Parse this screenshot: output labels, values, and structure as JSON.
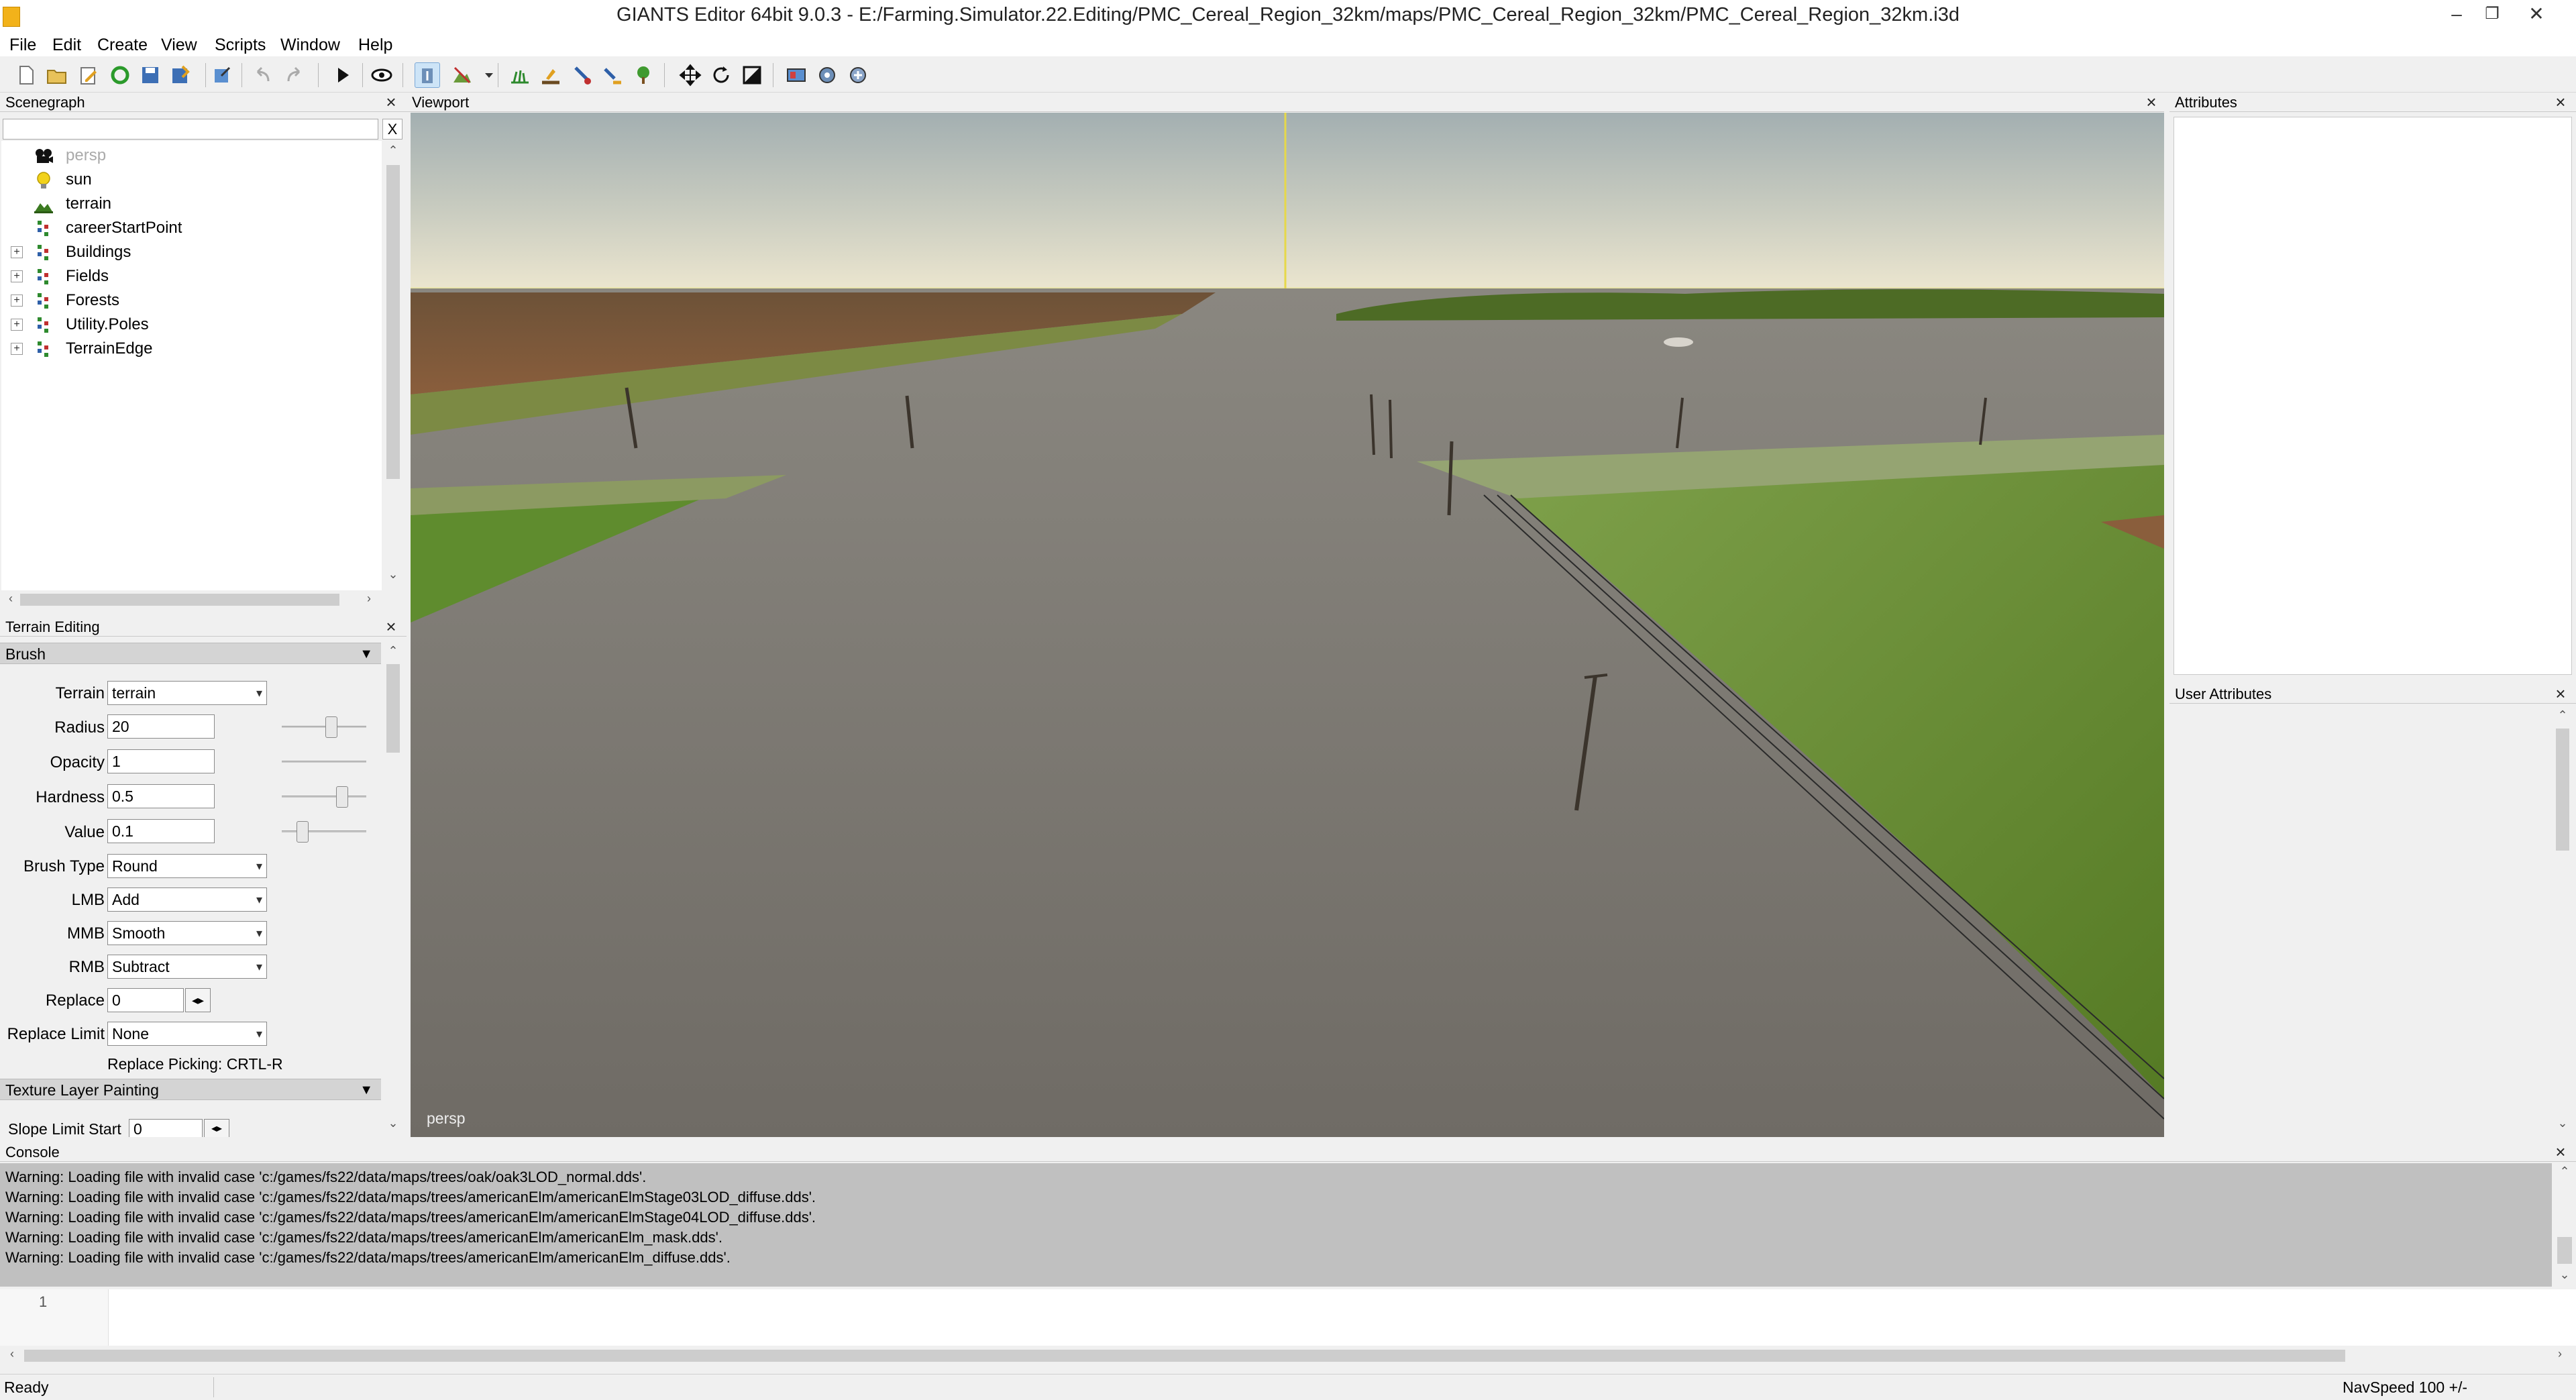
{
  "window": {
    "title": "GIANTS Editor 64bit 9.0.3 - E:/Farming.Simulator.22.Editing/PMC_Cereal_Region_32km/maps/PMC_Cereal_Region_32km/PMC_Cereal_Region_32km.i3d",
    "minimize": "–",
    "restore": "❐",
    "close": "✕"
  },
  "menu": [
    "File",
    "Edit",
    "Create",
    "View",
    "Scripts",
    "Window",
    "Help"
  ],
  "toolbar_icons": [
    "new-file-icon",
    "open-file-icon",
    "edit-file-icon",
    "reload-icon",
    "save-icon",
    "save-as-icon",
    "export-icon",
    "undo-icon",
    "redo-icon",
    "play-icon",
    "visibility-eye-icon",
    "select-mode-icon",
    "terrain-sculpt-icon",
    "dropdown-arrow-icon",
    "paint-grass-icon",
    "paint-texture-icon",
    "paint-foliage-icon",
    "decoration-icon",
    "place-tree-icon",
    "move-tool-icon",
    "rotate-tool-icon",
    "scale-tool-icon",
    "render-icon",
    "settings-gear-icon",
    "advanced-settings-icon"
  ],
  "scenegraph": {
    "title": "Scenegraph",
    "search_placeholder": "",
    "clear_label": "X",
    "nodes": [
      {
        "label": "persp",
        "icon": "camera-icon",
        "expandable": false,
        "dimmed": true
      },
      {
        "label": "sun",
        "icon": "light-bulb-icon",
        "expandable": false,
        "dimmed": false
      },
      {
        "label": "terrain",
        "icon": "terrain-icon",
        "expandable": false,
        "dimmed": false
      },
      {
        "label": "careerStartPoint",
        "icon": "transform-group-icon",
        "expandable": false,
        "dimmed": false
      },
      {
        "label": "Buildings",
        "icon": "transform-group-icon",
        "expandable": true,
        "dimmed": false
      },
      {
        "label": "Fields",
        "icon": "transform-group-icon",
        "expandable": true,
        "dimmed": false
      },
      {
        "label": "Forests",
        "icon": "transform-group-icon",
        "expandable": true,
        "dimmed": false
      },
      {
        "label": "Utility.Poles",
        "icon": "transform-group-icon",
        "expandable": true,
        "dimmed": false
      },
      {
        "label": "TerrainEdge",
        "icon": "transform-group-icon",
        "expandable": true,
        "dimmed": false
      }
    ]
  },
  "terrain_editing": {
    "title": "Terrain Editing",
    "brush_section": "Brush",
    "terrain_label": "Terrain",
    "terrain_value": "terrain",
    "radius_label": "Radius",
    "radius_value": "20",
    "radius_slider": 0.6,
    "opacity_label": "Opacity",
    "opacity_value": "1",
    "opacity_slider": 1.0,
    "hardness_label": "Hardness",
    "hardness_value": "0.5",
    "hardness_slider": 0.75,
    "value_label": "Value",
    "value_value": "0.1",
    "value_slider": 0.2,
    "brush_type_label": "Brush Type",
    "brush_type_value": "Round",
    "lmb_label": "LMB",
    "lmb_value": "Add",
    "mmb_label": "MMB",
    "mmb_value": "Smooth",
    "rmb_label": "RMB",
    "rmb_value": "Subtract",
    "replace_label": "Replace",
    "replace_value": "0",
    "replace_limit_label": "Replace Limit",
    "replace_limit_value": "None",
    "replace_picking": "Replace Picking: CRTL-R",
    "texture_section": "Texture Layer Painting",
    "slope_limit_label": "Slope Limit Start",
    "slope_limit_value": "0"
  },
  "viewport": {
    "title": "Viewport",
    "camera_label": "persp"
  },
  "attributes": {
    "title": "Attributes"
  },
  "user_attributes": {
    "title": "User Attributes"
  },
  "console": {
    "title": "Console",
    "lines": [
      "Warning: Loading file with invalid case 'c:/games/fs22/data/maps/trees/oak/oak3LOD_normal.dds'.",
      "Warning: Loading file with invalid case 'c:/games/fs22/data/maps/trees/americanElm/americanElmStage03LOD_diffuse.dds'.",
      "Warning: Loading file with invalid case 'c:/games/fs22/data/maps/trees/americanElm/americanElmStage04LOD_diffuse.dds'.",
      "Warning: Loading file with invalid case 'c:/games/fs22/data/maps/trees/americanElm/americanElm_mask.dds'.",
      "Warning: Loading file with invalid case 'c:/games/fs22/data/maps/trees/americanElm/americanElm_diffuse.dds'."
    ],
    "input_line_number": "1"
  },
  "status": {
    "text": "Ready",
    "navspeed": "NavSpeed 100 +/-"
  },
  "colors": {
    "panel_bg": "#f0f0f0",
    "console_bg": "#c0c0c0",
    "section_bar": "#d4d4d4",
    "sky_top": "#a9b7b8",
    "horizon": "#e9e4cf",
    "road": "#7a7670",
    "grass": "#6e8f3a",
    "soil": "#7d5a3c"
  }
}
